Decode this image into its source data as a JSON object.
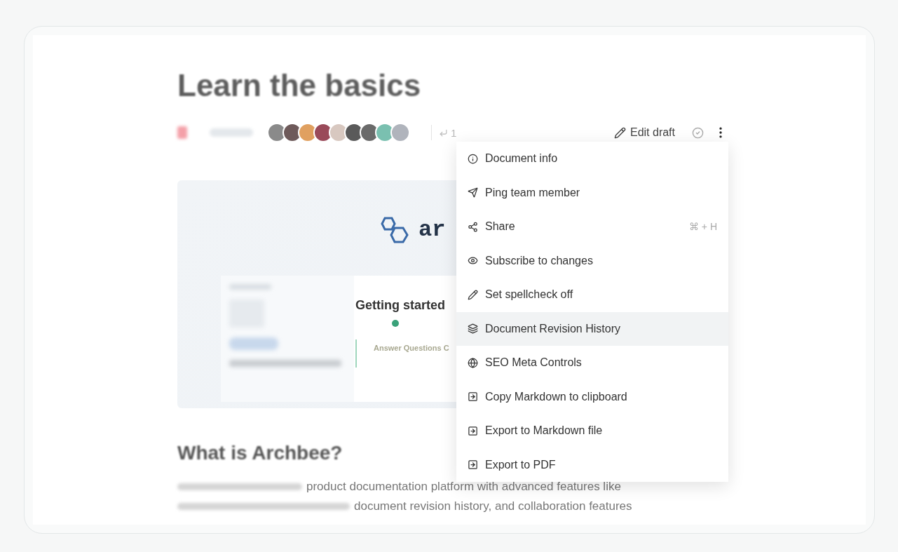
{
  "document": {
    "title": "Learn the basics",
    "meta": {
      "backlinks": "1",
      "edit_label": "Edit draft"
    },
    "avatars": [
      {
        "color": "#8a8a8a"
      },
      {
        "color": "#6e5a5a"
      },
      {
        "color": "#e0a060"
      },
      {
        "color": "#9a4a5a"
      },
      {
        "color": "#d8c8c0"
      },
      {
        "color": "#5a5a5a"
      },
      {
        "color": "#6a6a6a"
      },
      {
        "color": "#7ac0b0"
      },
      {
        "color": "#b0b4bc"
      }
    ],
    "cover": {
      "logo_text": "ar",
      "inner_title": "Getting started",
      "callout": "Answer Questions C"
    },
    "heading": "What is Archbee?",
    "paragraph_lines": [
      "product documentation platform with advanced features like",
      "document revision history, and collaboration features"
    ]
  },
  "menu": [
    {
      "label": "Document info",
      "selected": false
    },
    {
      "label": "Ping team member",
      "selected": false
    },
    {
      "label": "Share",
      "shortcut": "⌘ + H",
      "selected": false
    },
    {
      "label": "Subscribe to changes",
      "selected": false
    },
    {
      "label": "Set spellcheck off",
      "selected": false
    },
    {
      "label": "Document Revision History",
      "selected": true
    },
    {
      "label": "SEO Meta Controls",
      "selected": false
    },
    {
      "label": "Copy Markdown to clipboard",
      "selected": false
    },
    {
      "label": "Export to Markdown file",
      "selected": false
    },
    {
      "label": "Export to PDF",
      "selected": false
    }
  ]
}
